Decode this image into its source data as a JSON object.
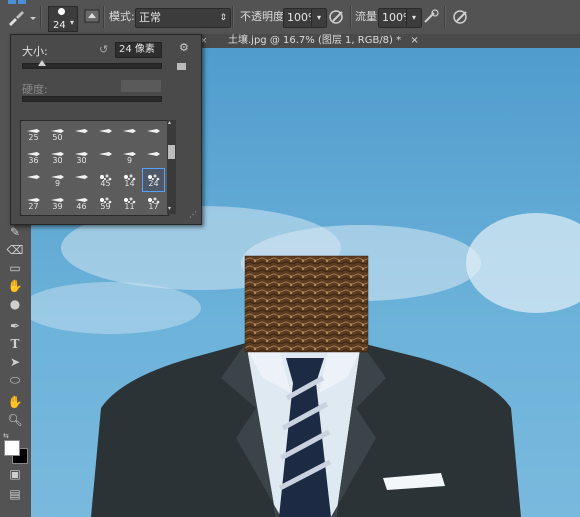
{
  "options_bar": {
    "brush_size": "24",
    "mode_label": "模式:",
    "mode_value": "正常",
    "opacity_label": "不透明度:",
    "opacity_value": "100%",
    "flow_label": "流量:",
    "flow_value": "100%"
  },
  "document_tab": {
    "title": "土壤.jpg @ 16.7% (图层 1, RGB/8) *",
    "close": "×"
  },
  "brush_panel": {
    "size_label": "大小:",
    "size_value": "24 像素",
    "hardness_label": "硬度:",
    "size_fraction": 0.05,
    "presets": [
      {
        "size": "25"
      },
      {
        "size": "50"
      },
      {
        "size": ""
      },
      {
        "size": ""
      },
      {
        "size": ""
      },
      {
        "size": ""
      },
      {
        "size": "36"
      },
      {
        "size": "30"
      },
      {
        "size": "30"
      },
      {
        "size": ""
      },
      {
        "size": "9"
      },
      {
        "size": ""
      },
      {
        "size": ""
      },
      {
        "size": "9"
      },
      {
        "size": ""
      },
      {
        "size": "45"
      },
      {
        "size": "14"
      },
      {
        "size": "24"
      },
      {
        "size": "27"
      },
      {
        "size": "39"
      },
      {
        "size": "46"
      },
      {
        "size": "59"
      },
      {
        "size": "11"
      },
      {
        "size": "17"
      }
    ],
    "selected_index": 17
  },
  "colors": {
    "sky": "#62a9d2",
    "suit": "#2b3336",
    "shirt": "#dfe9f2",
    "tie_dark": "#1d2a44",
    "tie_stripe": "#c9d2de",
    "soil": "#6b4a2e",
    "selected_outline": "#5aa0ff"
  },
  "tools": [
    "move-icon",
    "marquee-icon",
    "lasso-icon",
    "quick-select-icon",
    "crop-icon",
    "eyedropper-icon",
    "healing-icon",
    "brush-icon",
    "stamp-icon",
    "history-brush-icon",
    "eraser-icon",
    "gradient-icon",
    "blur-icon",
    "dodge-icon",
    "pen-icon",
    "type-icon",
    "path-select-icon",
    "shape-icon",
    "hand-icon",
    "zoom-icon"
  ]
}
